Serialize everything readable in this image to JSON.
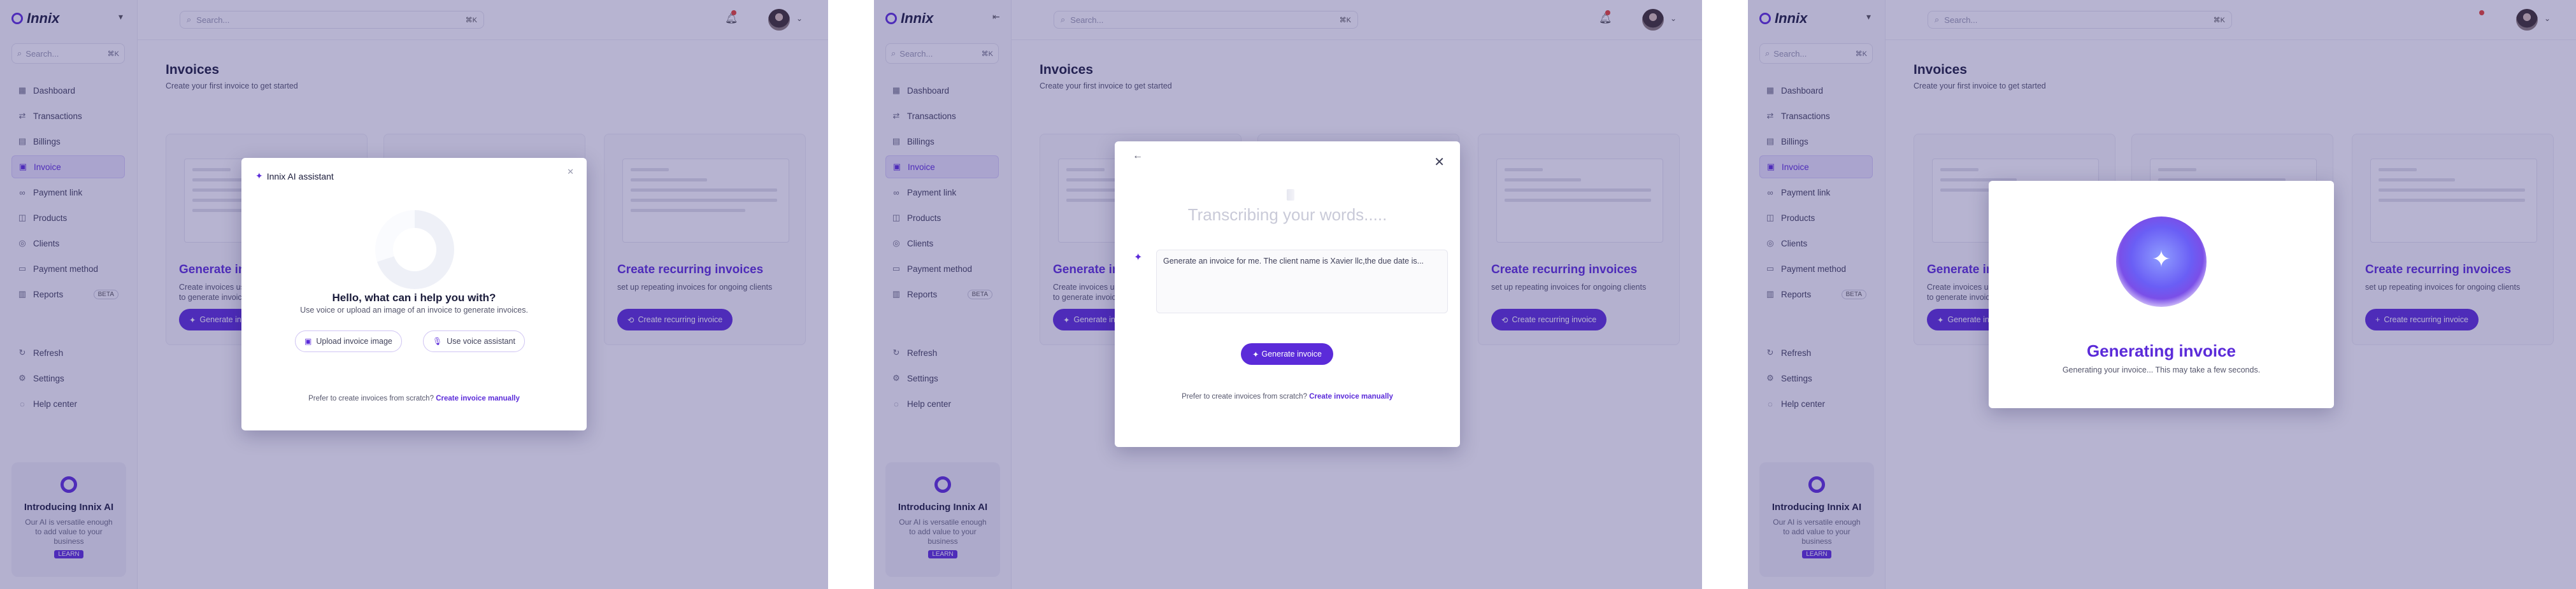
{
  "brand": {
    "name": "Innix",
    "accent": "#5b2bd9"
  },
  "sidebar": {
    "search_placeholder": "Search...",
    "search_shortcut": "⌘K",
    "items": [
      {
        "label": "Dashboard",
        "icon": "dashboard-icon"
      },
      {
        "label": "Transactions",
        "icon": "transactions-icon"
      },
      {
        "label": "Billings",
        "icon": "billings-icon"
      },
      {
        "label": "Invoice",
        "icon": "invoice-icon",
        "active": true
      },
      {
        "label": "Payment link",
        "icon": "payment-link-icon"
      },
      {
        "label": "Products",
        "icon": "products-icon"
      },
      {
        "label": "Clients",
        "icon": "clients-icon"
      },
      {
        "label": "Payment method",
        "icon": "payment-method-icon"
      },
      {
        "label": "Reports",
        "icon": "reports-icon",
        "badge": "BETA"
      }
    ],
    "bottom_items": [
      {
        "label": "Refresh",
        "icon": "refresh-icon"
      },
      {
        "label": "Settings",
        "icon": "settings-icon"
      },
      {
        "label": "Help center",
        "icon": "help-icon"
      }
    ],
    "promo": {
      "title": "Introducing Innix AI",
      "text": "Our AI is versatile enough to add value to your business",
      "button": "LEARN"
    }
  },
  "topbar": {
    "search_placeholder": "Search...",
    "search_shortcut": "⌘K"
  },
  "page": {
    "title": "Invoices",
    "subtitle": "Create your first invoice to get started",
    "cards": [
      {
        "title": "Generate invoice",
        "desc": "Create invoices using AI, use your voice or upload to generate invoice",
        "button": "Generate invoice"
      },
      {
        "title": "",
        "desc": "",
        "button": ""
      },
      {
        "title": "Create recurring invoices",
        "desc": "set up repeating invoices for ongoing clients",
        "button": "Create recurring invoice"
      }
    ]
  },
  "modal_assistant": {
    "header": "Innix AI assistant",
    "title": "Hello, what can i help you with?",
    "subtitle": "Use voice or upload an image of an invoice to generate invoices.",
    "upload_button": "Upload invoice image",
    "voice_button": "Use voice assistant",
    "footer_text": "Prefer to create invoices from scratch?",
    "footer_link": "Create invoice manually"
  },
  "modal_transcribe": {
    "title": "Transcribing your words.....",
    "transcript": "Generate an invoice for me. The client name is Xavier llc,the due date is...",
    "button": "Generate invoice",
    "footer_text": "Prefer to create invoices from scratch?",
    "footer_link": "Create invoice manually"
  },
  "modal_generating": {
    "title": "Generating invoice",
    "subtitle": "Generating your invoice... This may take a few seconds."
  }
}
